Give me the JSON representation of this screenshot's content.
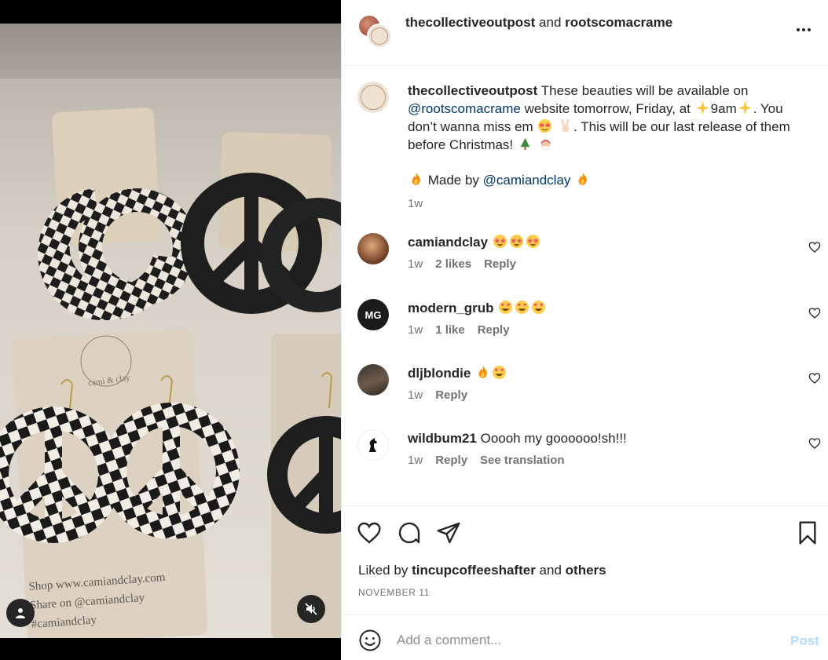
{
  "post": {
    "author": "thecollectiveoutpost",
    "connector": "and",
    "collaborator": "rootscomacrame"
  },
  "media": {
    "text_line1": "Shop www.camiandclay.com",
    "text_line2": "Share on @camiandclay",
    "text_line3": "#camiandclay",
    "card_brand": "cami & clay"
  },
  "caption": {
    "username": "thecollectiveoutpost",
    "text_a": "These beauties will be available on",
    "mention_1": "@rootscomacrame",
    "text_b": "website tomorrow, Friday, at",
    "time": "9am",
    "text_c": ". You don’t wanna miss em",
    "text_d": ". This will be our last release of them before Christmas!",
    "made_by": "Made by",
    "mention_2": "@camiandclay",
    "timestamp": "1w"
  },
  "comments": [
    {
      "username": "camiandclay",
      "text": "",
      "time": "1w",
      "likes": "2 likes",
      "reply": "Reply",
      "translation": ""
    },
    {
      "username": "modern_grub",
      "text": "",
      "time": "1w",
      "likes": "1 like",
      "reply": "Reply",
      "translation": ""
    },
    {
      "username": "dljblondie",
      "text": "",
      "time": "1w",
      "likes": "",
      "reply": "Reply",
      "translation": ""
    },
    {
      "username": "wildbum21",
      "text": "Ooooh my goooooo!sh!!!",
      "time": "1w",
      "likes": "",
      "reply": "Reply",
      "translation": "See translation"
    }
  ],
  "avatars": {
    "modern_grub": "MG"
  },
  "engagement": {
    "liked_by_prefix": "Liked by",
    "liked_by_user": "tincupcoffeeshafter",
    "liked_by_and": "and",
    "liked_by_others": "others",
    "date": "NOVEMBER 11"
  },
  "composer": {
    "placeholder": "Add a comment...",
    "post_label": "Post"
  },
  "colors": {
    "link": "#00376b",
    "muted": "#737373",
    "post_disabled": "#b3dbff"
  }
}
